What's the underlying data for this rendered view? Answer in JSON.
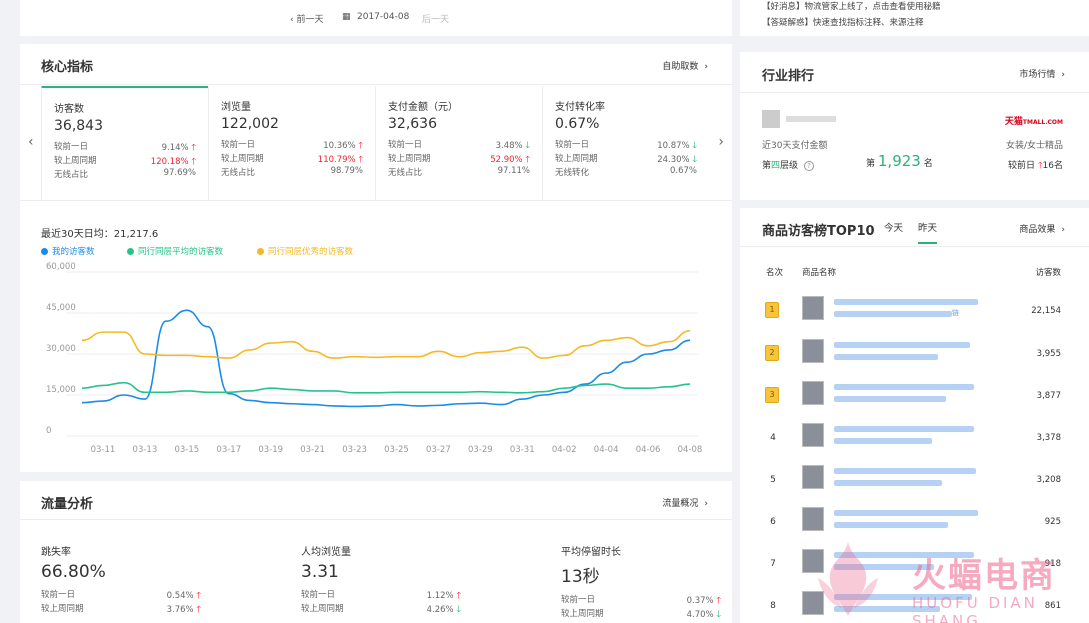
{
  "date_nav": {
    "prev": "前一天",
    "date": "2017-04-08",
    "next": "后一天",
    "prev_chev": "‹",
    "cal": "▦"
  },
  "core": {
    "title": "核心指标",
    "link": "自助取数",
    "metrics": [
      {
        "title": "访客数",
        "value": "36,843",
        "r1_label": "较前一日",
        "r1_val": "9.14%",
        "r2_label": "较上周同期",
        "r2_val": "120.18%",
        "r3_label": "无线占比",
        "r3_val": "97.69%"
      },
      {
        "title": "浏览量",
        "value": "122,002",
        "r1_label": "较前一日",
        "r1_val": "10.36%",
        "r2_label": "较上周同期",
        "r2_val": "110.79%",
        "r3_label": "无线占比",
        "r3_val": "98.79%"
      },
      {
        "title": "支付金额（元）",
        "value": "32,636",
        "r1_label": "较前一日",
        "r1_val": "3.48%",
        "r2_label": "较上周同期",
        "r2_val": "52.90%",
        "r3_label": "无线占比",
        "r3_val": "97.11%"
      },
      {
        "title": "支付转化率",
        "value": "0.67%",
        "r1_label": "较前一日",
        "r1_val": "10.87%",
        "r2_label": "较上周同期",
        "r2_val": "24.30%",
        "r3_label": "无线转化",
        "r3_val": "0.67%"
      }
    ],
    "avg_label": "最近30天日均：21,217.6"
  },
  "chart_data": {
    "type": "line",
    "x": [
      "03-10",
      "03-11",
      "03-12",
      "03-13",
      "03-14",
      "03-15",
      "03-16",
      "03-17",
      "03-18",
      "03-19",
      "03-20",
      "03-21",
      "03-22",
      "03-23",
      "03-24",
      "03-25",
      "03-26",
      "03-27",
      "03-28",
      "03-29",
      "03-30",
      "03-31",
      "04-01",
      "04-02",
      "04-03",
      "04-04",
      "04-05",
      "04-06",
      "04-07",
      "04-08"
    ],
    "xticks": [
      "03-11",
      "03-13",
      "03-15",
      "03-17",
      "03-19",
      "03-21",
      "03-23",
      "03-25",
      "03-27",
      "03-29",
      "03-31",
      "04-02",
      "04-04",
      "04-06",
      "04-08"
    ],
    "yticks": [
      "0",
      "15,000",
      "30,000",
      "45,000",
      "60,000"
    ],
    "ylim": [
      0,
      60000
    ],
    "grid": true,
    "legend_position": "top-left",
    "series": [
      {
        "name": "我的访客数",
        "color": "#1a8ce8",
        "values": [
          12200,
          12800,
          15000,
          13500,
          42000,
          46000,
          40000,
          15500,
          13000,
          12200,
          11800,
          11500,
          11000,
          10800,
          11000,
          11500,
          11000,
          11200,
          11800,
          12000,
          11500,
          13500,
          15000,
          16000,
          19000,
          23000,
          27000,
          30000,
          31500,
          35000
        ]
      },
      {
        "name": "同行同层平均的访客数",
        "color": "#27c38a",
        "values": [
          17500,
          18500,
          19500,
          16000,
          16000,
          16500,
          16000,
          16000,
          16500,
          17500,
          17000,
          16500,
          16500,
          15800,
          15800,
          16000,
          16000,
          16000,
          16000,
          16200,
          16000,
          15800,
          16200,
          17500,
          18500,
          19000,
          17500,
          17500,
          18000,
          19000
        ]
      },
      {
        "name": "同行同层优秀的访客数",
        "color": "#f5b925",
        "values": [
          35000,
          38000,
          38000,
          30000,
          29500,
          29500,
          29000,
          28500,
          31500,
          34000,
          34500,
          31000,
          28500,
          29000,
          28800,
          29000,
          29000,
          31000,
          29000,
          30500,
          31000,
          32500,
          28500,
          29500,
          33000,
          35000,
          36000,
          33000,
          34500,
          38500
        ]
      }
    ]
  },
  "traffic": {
    "title": "流量分析",
    "link": "流量概况",
    "metrics": [
      {
        "title": "跳失率",
        "value": "66.80%",
        "r1_label": "较前一日",
        "r1_val": "0.54%",
        "r2_label": "较上周同期",
        "r2_val": "3.76%"
      },
      {
        "title": "人均浏览量",
        "value": "3.31",
        "r1_label": "较前一日",
        "r1_val": "1.12%",
        "r2_label": "较上周同期",
        "r2_val": "4.26%"
      },
      {
        "title": "平均停留时长",
        "value": "13秒",
        "r1_label": "较前一日",
        "r1_val": "0.37%",
        "r2_label": "较上周同期",
        "r2_val": "4.70%"
      }
    ]
  },
  "notice": {
    "line1": "【好消息】物流管家上线了，点击查看使用秘籍",
    "line2": "【答疑解惑】快速查找指标注释、来源注释"
  },
  "industry": {
    "title": "行业排行",
    "link": "市场行情",
    "tmall": "天猫",
    "tmall_sub": "TMALL.COM",
    "pay_label": "近30天支付金额",
    "category": "女装/女士精品",
    "layer_prefix": "第",
    "layer_num": "四",
    "layer_suffix": "层级",
    "rank_prefix": "第",
    "rank_value": "1,923",
    "rank_suffix": "名",
    "compare_label": "较前日",
    "compare_val": "16名"
  },
  "top10": {
    "title": "商品访客榜TOP10",
    "tab_today": "今天",
    "tab_yesterday": "昨天",
    "link": "商品效果",
    "col_rank": "名次",
    "col_name": "商品名称",
    "col_visitors": "访客数",
    "rows": [
      {
        "rank": "1",
        "visitors": "22,154",
        "tail": "链"
      },
      {
        "rank": "2",
        "visitors": "3,955"
      },
      {
        "rank": "3",
        "visitors": "3,877"
      },
      {
        "rank": "4",
        "visitors": "3,378"
      },
      {
        "rank": "5",
        "visitors": "3,208"
      },
      {
        "rank": "6",
        "visitors": "925"
      },
      {
        "rank": "7",
        "visitors": "918"
      },
      {
        "rank": "8",
        "visitors": "861"
      }
    ]
  },
  "watermark": {
    "title": "火蝠电商",
    "sub": "HUOFU DIAN SHANG"
  }
}
